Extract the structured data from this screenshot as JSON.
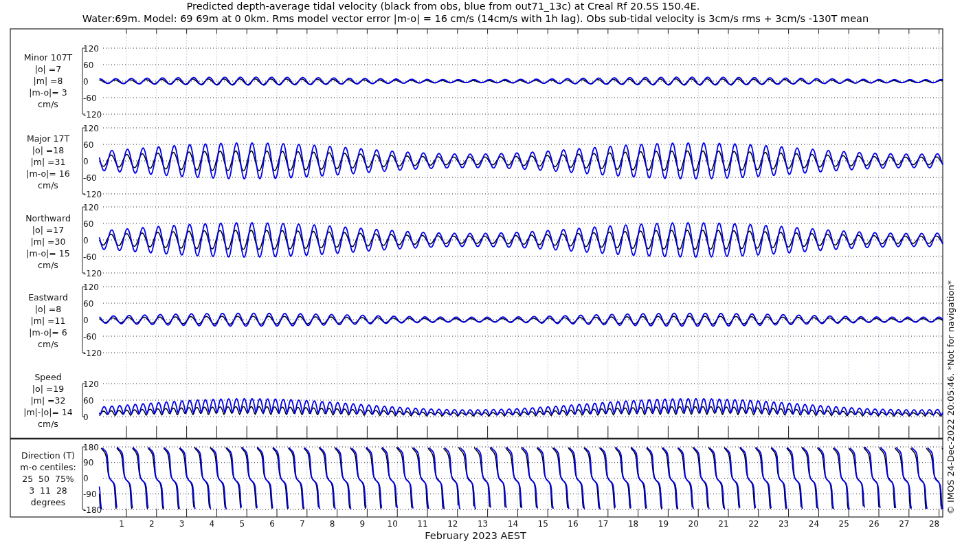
{
  "title_lines": [
    "Predicted depth-average tidal velocity (black from obs, blue from out71_13c) at Creal Rf 20.5S 150.4E.",
    "Water:69m. Model: 69 69m at 0 0km. Rms model vector error |m-o| = 16 cm/s (14cm/s with 1h lag). Obs sub-tidal velocity is 3cm/s rms + 3cm/s -130T mean"
  ],
  "panels": [
    {
      "kind": "minor",
      "label_lines": [
        "Minor 107T",
        "|o| =7",
        "|m| =8",
        "|m-o|= 3",
        "cm/s"
      ],
      "yticks": [
        "120",
        "60",
        "0",
        "-60",
        "-120"
      ]
    },
    {
      "kind": "major",
      "label_lines": [
        "Major 17T",
        "|o| =18",
        "|m| =31",
        "|m-o|= 16",
        "cm/s"
      ],
      "yticks": [
        "120",
        "60",
        "0",
        "-60",
        "-120"
      ]
    },
    {
      "kind": "northward",
      "label_lines": [
        "Northward",
        "|o| =17",
        "|m| =30",
        "|m-o|= 15",
        "cm/s"
      ],
      "yticks": [
        "120",
        "60",
        "0",
        "-60",
        "-120"
      ]
    },
    {
      "kind": "eastward",
      "label_lines": [
        "Eastward",
        "|o| =8",
        "|m| =11",
        "|m-o|= 6",
        "cm/s"
      ],
      "yticks": [
        "120",
        "60",
        "0",
        "-60",
        "-120"
      ]
    },
    {
      "kind": "speed",
      "label_lines": [
        "Speed",
        "|o| =19",
        "|m| =32",
        "|m|-|o|= 14",
        "cm/s"
      ],
      "yticks": [
        "120",
        "60",
        "0"
      ]
    },
    {
      "kind": "direction",
      "label_lines": [
        "Direction (T)",
        "m-o centiles:",
        "25  50  75%",
        "3  11  28",
        "degrees"
      ],
      "yticks": [
        "180",
        "90",
        "0",
        "-90",
        "-180"
      ]
    }
  ],
  "x_tick_labels": [
    "1",
    "2",
    "3",
    "4",
    "5",
    "6",
    "7",
    "8",
    "9",
    "10",
    "11",
    "12",
    "13",
    "14",
    "15",
    "16",
    "17",
    "18",
    "19",
    "20",
    "21",
    "22",
    "23",
    "24",
    "25",
    "26",
    "27",
    "28"
  ],
  "xlabel": "February 2023 AEST",
  "footer_note": "© IMOS 24-Dec-2022 20:05:46. *Not for navigation*"
}
